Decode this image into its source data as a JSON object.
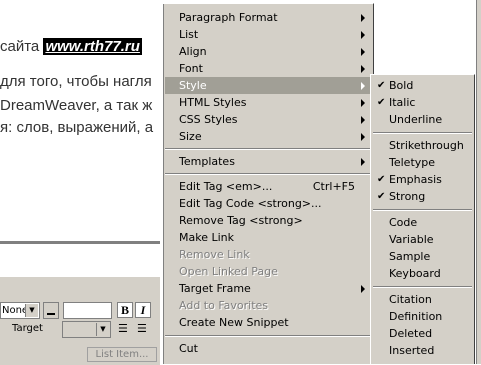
{
  "document": {
    "line1_prefix": "сайта",
    "line1_link": "www.rth77.ru",
    "line2": "для того, чтобы нагля",
    "line3": "DreamWeaver, а так ж",
    "line4": "я: слов, выражений, а"
  },
  "properties": {
    "format_select": "None",
    "bold_label": "B",
    "italic_label": "I",
    "target_label": "Target",
    "list_item_button": "List Item..."
  },
  "menu": {
    "paragraph_format": "Paragraph Format",
    "list": "List",
    "align": "Align",
    "font": "Font",
    "style": "Style",
    "html_styles": "HTML Styles",
    "css_styles": "CSS Styles",
    "size": "Size",
    "templates": "Templates",
    "edit_tag": "Edit Tag <em>...",
    "edit_tag_shortcut": "Ctrl+F5",
    "edit_tag_code": "Edit Tag Code <strong>...",
    "remove_tag": "Remove Tag <strong>",
    "make_link": "Make Link",
    "remove_link": "Remove Link",
    "open_linked_page": "Open Linked Page",
    "target_frame": "Target Frame",
    "add_to_favorites": "Add to Favorites",
    "create_new_snippet": "Create New Snippet",
    "cut": "Cut"
  },
  "style_submenu": {
    "bold": "Bold",
    "italic": "Italic",
    "underline": "Underline",
    "strikethrough": "Strikethrough",
    "teletype": "Teletype",
    "emphasis": "Emphasis",
    "strong": "Strong",
    "code": "Code",
    "variable": "Variable",
    "sample": "Sample",
    "keyboard": "Keyboard",
    "citation": "Citation",
    "definition": "Definition",
    "deleted": "Deleted",
    "inserted": "Inserted"
  },
  "colors": {
    "menu_bg": "#d4d0c8",
    "highlight_bg": "#a19f96",
    "disabled_text": "#808080"
  },
  "icons": {
    "check": "checkmark-icon",
    "submenu_arrow": "submenu-arrow-icon"
  }
}
